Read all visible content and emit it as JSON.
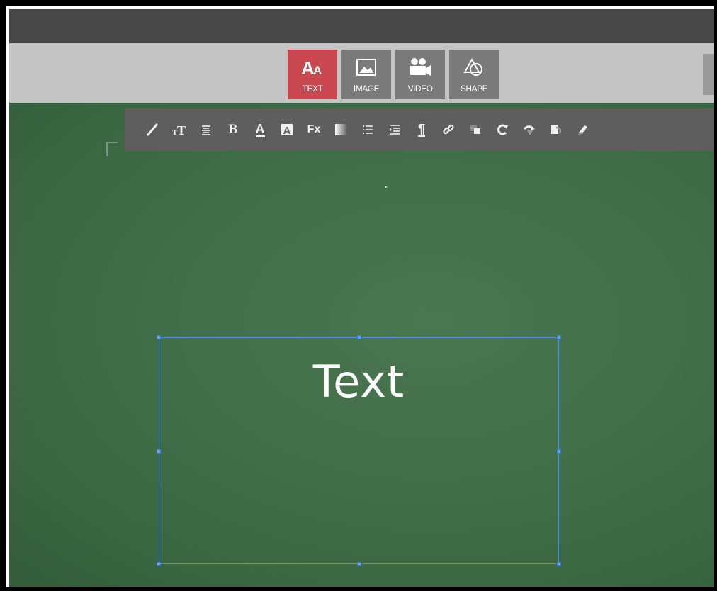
{
  "toolbar": {
    "buttons": [
      {
        "label": "TEXT",
        "icon": "text-aa-icon",
        "active": true
      },
      {
        "label": "IMAGE",
        "icon": "image-icon",
        "active": false
      },
      {
        "label": "VIDEO",
        "icon": "video-camera-icon",
        "active": false
      },
      {
        "label": "SHAPE",
        "icon": "shape-icon",
        "active": false
      }
    ],
    "accent_color": "#c9474e"
  },
  "format_toolbar": {
    "icons": [
      "brush-icon",
      "font-size-icon",
      "align-center-icon",
      "bold-icon",
      "font-color-icon",
      "text-background-icon",
      "clear-format-icon",
      "gradient-icon",
      "bullet-list-icon",
      "indent-icon",
      "paragraph-icon",
      "link-icon",
      "layer-icon",
      "rotate-icon",
      "forward-icon",
      "duplicate-icon",
      "delete-icon"
    ],
    "bold_glyph": "B",
    "font_color_glyph": "A",
    "clear_format_glyph": "Fx",
    "paragraph_glyph": "¶"
  },
  "canvas": {
    "background_color": "#3f6b47",
    "textbox": {
      "text": "Text"
    }
  }
}
